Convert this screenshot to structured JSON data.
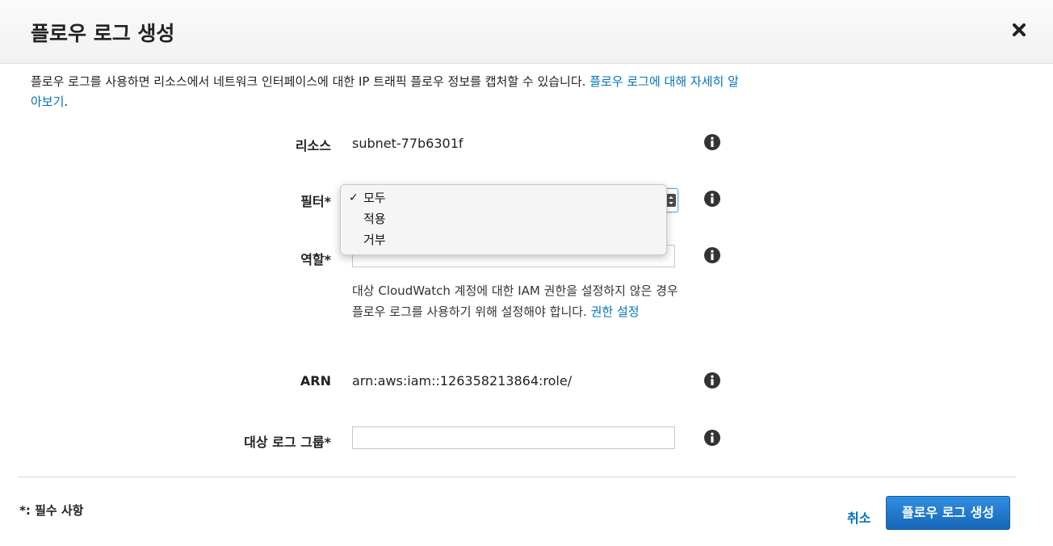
{
  "dialog": {
    "title": "플로우 로그 생성",
    "description": "플로우 로그를 사용하면 리소스에서 네트워크 인터페이스에 대한 IP 트래픽 플로우 정보를 캡처할 수 있습니다. ",
    "learn_more_link": "플로우 로그에 대해 자세히 알아보기",
    "description_end": "."
  },
  "form": {
    "resource": {
      "label": "리소스",
      "value": "subnet-77b6301f"
    },
    "filter": {
      "label": "필터*",
      "options": [
        {
          "label": "모두",
          "checked": true
        },
        {
          "label": "적용",
          "checked": false
        },
        {
          "label": "거부",
          "checked": false
        }
      ]
    },
    "role": {
      "label": "역할*",
      "help_text": "대상 CloudWatch 계정에 대한 IAM 권한을 설정하지 않은 경우 플로우 로그를 사용하기 위해 설정해야 합니다. ",
      "help_link": "권한 설정"
    },
    "arn": {
      "label": "ARN",
      "value": "arn:aws:iam::126358213864:role/"
    },
    "log_group": {
      "label": "대상 로그 그룹*",
      "value": ""
    }
  },
  "footer": {
    "required_note": "*: 필수 사항",
    "cancel_label": "취소",
    "submit_label": "플로우 로그 생성"
  },
  "icons": {
    "close": "close-icon",
    "info": "info-icon",
    "check": "checkmark-icon"
  },
  "colors": {
    "link": "#0073bb",
    "primary_button": "#1f7cd2",
    "info_icon": "#333333"
  }
}
